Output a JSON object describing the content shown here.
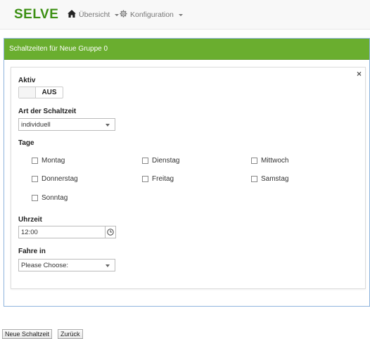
{
  "navbar": {
    "brand": "SELVE",
    "menu": [
      {
        "label": "Übersicht",
        "icon": "home-icon"
      },
      {
        "label": "Konfiguration",
        "icon": "gear-icon"
      }
    ]
  },
  "panel": {
    "title": "Schaltzeiten für Neue Gruppe 0",
    "close_label": "×",
    "aktiv": {
      "label": "Aktiv",
      "state": "AUS"
    },
    "art": {
      "label": "Art der Schaltzeit",
      "value": "individuell"
    },
    "tage": {
      "label": "Tage",
      "days": [
        {
          "label": "Montag",
          "checked": false
        },
        {
          "label": "Dienstag",
          "checked": false
        },
        {
          "label": "Mittwoch",
          "checked": false
        },
        {
          "label": "Donnerstag",
          "checked": false
        },
        {
          "label": "Freitag",
          "checked": false
        },
        {
          "label": "Samstag",
          "checked": false
        },
        {
          "label": "Sonntag",
          "checked": false
        }
      ]
    },
    "uhrzeit": {
      "label": "Uhrzeit",
      "value": "12:00",
      "icon": "clock-icon"
    },
    "fahre_in": {
      "label": "Fahre in",
      "value": "Please Choose:"
    }
  },
  "footer": {
    "new_label": "Neue Schaltzeit",
    "back_label": "Zurück"
  }
}
